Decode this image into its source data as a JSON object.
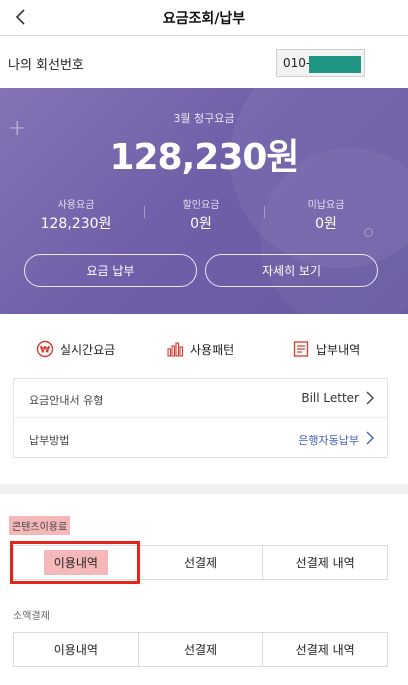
{
  "header": {
    "title": "요금조회/납부"
  },
  "line": {
    "label": "나의 회선번호",
    "number_prefix": "010-"
  },
  "bill": {
    "month_label": "3월 청구요금",
    "amount": "128,230원",
    "stats": [
      {
        "label": "사용요금",
        "value": "128,230원"
      },
      {
        "label": "할인요금",
        "value": "0원"
      },
      {
        "label": "미납요금",
        "value": "0원"
      }
    ],
    "pay_button": "요금 납부",
    "detail_button": "자세히 보기"
  },
  "quick_menu": [
    {
      "label": "실시간요금",
      "icon": "won-circle-icon"
    },
    {
      "label": "사용패턴",
      "icon": "bar-chart-icon"
    },
    {
      "label": "납부내역",
      "icon": "document-icon"
    }
  ],
  "info": {
    "rows": [
      {
        "label": "요금안내서 유형",
        "value": "Bill Letter"
      },
      {
        "label": "납부방법",
        "value": "은행자동납부"
      }
    ]
  },
  "content_fee": {
    "label": "콘텐츠이용료",
    "tabs": [
      "이용내역",
      "선결제",
      "선결제 내역"
    ]
  },
  "micro_payment": {
    "label": "소액결제",
    "tabs": [
      "이용내역",
      "선결제",
      "선결제 내역"
    ]
  },
  "colors": {
    "hero": "#6f5ea8",
    "accent_link": "#4960b8",
    "highlight": "#f5b8b8",
    "frame": "#e3261c",
    "mask": "#1f9683"
  }
}
